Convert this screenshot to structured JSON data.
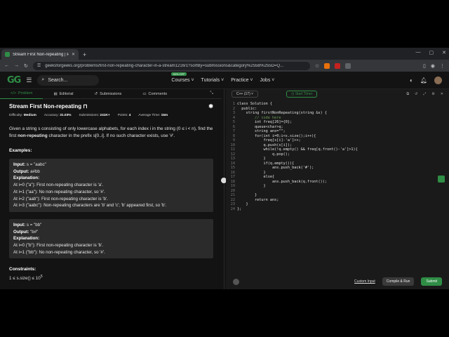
{
  "browser": {
    "tab_title": "Stream First Non-repeating | Pr",
    "url": "geeksforgeeks.org/problems/first-non-repeating-character-in-a-stream1216/1?sortBy=submissions&category%255B%255D=Q..."
  },
  "header": {
    "search_placeholder": "Search...",
    "nav": [
      {
        "label": "Courses",
        "badge": "90% OFF"
      },
      {
        "label": "Tutorials"
      },
      {
        "label": "Practice"
      },
      {
        "label": "Jobs"
      }
    ]
  },
  "left_tabs": [
    "Problem",
    "Editorial",
    "Submissions",
    "Comments"
  ],
  "problem": {
    "title": "Stream First Non-repeating",
    "difficulty_label": "Difficulty:",
    "difficulty": "Medium",
    "accuracy_label": "Accuracy:",
    "accuracy": "31.03%",
    "submissions_label": "Submissions:",
    "submissions": "241K+",
    "points_label": "Points:",
    "points": "4",
    "time_label": "Average Time:",
    "time": "15m",
    "description_1": "Given a string s consisting of only lowercase alphabets, for each index i in the string (0 ≤ i < n), find the first ",
    "description_bold": "non-repeating",
    "description_2": " character in the prefix s[0..i]. If no such character exists, use '#'.",
    "examples_heading": "Examples:",
    "example1": {
      "input": "s = \"aabc\"",
      "output": "a#bb",
      "lines": [
        "At i=0 (\"a\"): First non-repeating character is 'a'.",
        "At i=1 (\"aa\"): No non-repeating character, so '#'.",
        "At i=2 (\"aab\"): First non-repeating character is 'b'.",
        "At i=3 (\"aabc\"): Non-repeating characters are 'b' and 'c'; 'b' appeared first, so 'b'."
      ]
    },
    "example2": {
      "input": "s = \"bb\"",
      "output": "\"b#\"",
      "lines": [
        "At i=0 (\"b\"): First non-repeating character is 'b'.",
        "At i=1 (\"bb\"): No non-repeating character, so '#'."
      ]
    },
    "labels": {
      "input": "Input:",
      "output": "Output:",
      "explanation": "Explanation:"
    },
    "constraints_heading": "Constraints:",
    "constraint": "1 ≤ s.size() ≤ 10",
    "constraint_exp": "5"
  },
  "editor": {
    "language": "C++ (17)",
    "timer": "Start Timer",
    "lines": [
      "class Solution {",
      "  public:",
      "    string firstNonRepeating(string &s) {",
      "        // code here",
      "        int freq[26]={0};",
      "        queue<char>q;",
      "        string ans=\"\";",
      "        for(int i=0;i<s.size();i++){",
      "            freq[s[i]-'a']++;",
      "            q.push(s[i]);",
      "            while(!q.empty() && freq[q.front()-'a']>1){",
      "                q.pop();",
      "            }",
      "            if(q.empty()){",
      "                ans.push_back('#');",
      "            }",
      "            else{",
      "                ans.push_back(q.front());",
      "            }",
      "",
      "        }",
      "        return ans;",
      "    }",
      "};"
    ],
    "custom_input": "Custom Input",
    "compile_run": "Compile & Run",
    "submit": "Submit"
  }
}
